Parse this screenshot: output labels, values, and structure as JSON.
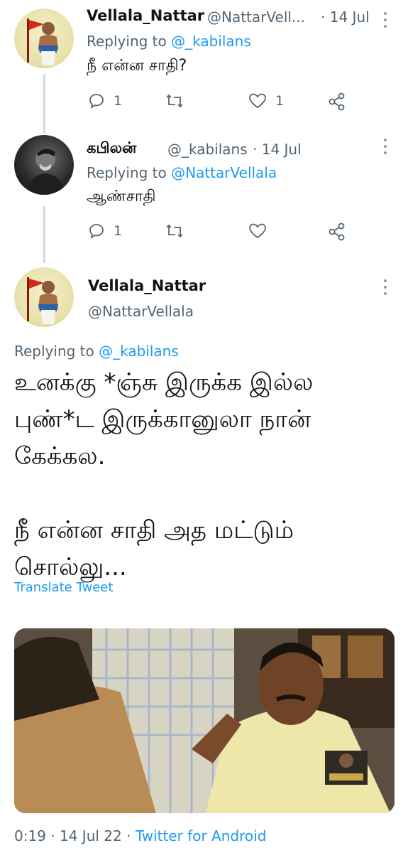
{
  "tweet1": {
    "name": "Vellala_Nattar",
    "handle": "@NattarVell...",
    "date": "· 14 Jul",
    "replying_prefix": "Replying to",
    "replying_handle": "@_kabilans",
    "text": "நீ என்ன சாதி?",
    "reply_count": "1",
    "retweet_count": "",
    "like_count": "1"
  },
  "tweet2": {
    "name": "கபிலன்",
    "handle": "@_kabilans",
    "date": "· 14 Jul",
    "replying_prefix": "Replying to",
    "replying_handle": "@NattarVellala",
    "text": "ஆண்சாதி",
    "reply_count": "1",
    "retweet_count": "",
    "like_count": ""
  },
  "main": {
    "name": "Vellala_Nattar",
    "handle": "@NattarVellala",
    "replying_prefix": "Replying to",
    "replying_handle": "@_kabilans",
    "lines": [
      "உனக்கு *ஞ்சு இருக்க இல்ல",
      "புண்*ட இருக்கானுலா நான்",
      "கேக்கல.",
      "",
      "நீ என்ன சாதி அத மட்டும்",
      "சொல்லு..."
    ],
    "translate": "Translate Tweet",
    "time": "0:19 · 14 Jul 22 ·",
    "source": "Twitter for Android"
  },
  "colors": {
    "accent": "#1d9bf0",
    "muted": "#536471",
    "text": "#0f1419",
    "thread_line": "#cfd9de"
  },
  "icons": [
    "reply-icon",
    "retweet-icon",
    "like-icon",
    "share-icon",
    "more-icon"
  ]
}
